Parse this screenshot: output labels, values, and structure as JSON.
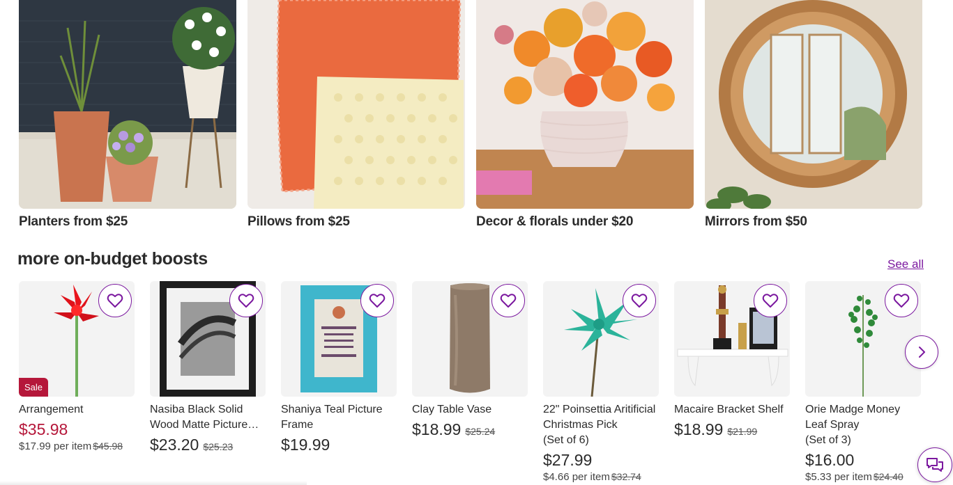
{
  "categories": [
    {
      "label": "Planters from $25"
    },
    {
      "label": "Pillows from $25"
    },
    {
      "label": "Decor & florals under $20"
    },
    {
      "label": "Mirrors from $50"
    }
  ],
  "section": {
    "title": "more on-budget boosts",
    "see_all": "See all"
  },
  "products": [
    {
      "name": "Arrangement",
      "badge": "Sale",
      "price": "$35.98",
      "per_item": "$17.99 per item",
      "was": "$45.98"
    },
    {
      "name": "Nasiba Black Solid Wood Matte Picture…",
      "price": "$23.20",
      "was": "$25.23"
    },
    {
      "name": "Shaniya Teal Picture Frame",
      "price": "$19.99"
    },
    {
      "name": "Clay Table Vase",
      "price": "$18.99",
      "was": "$25.24"
    },
    {
      "name": "22\" Poinsettia Aritificial Christmas Pick",
      "set": "(Set of 6)",
      "price": "$27.99",
      "per_item": "$4.66 per item",
      "was": "$32.74"
    },
    {
      "name": "Macaire Bracket Shelf",
      "price": "$18.99",
      "was": "$21.99"
    },
    {
      "name": "Orie Madge Money Leaf Spray",
      "set": "(Set of 3)",
      "price": "$16.00",
      "per_item": "$5.33 per item",
      "was": "$24.40"
    }
  ],
  "icons": {
    "favorite": "heart-icon",
    "next": "chevron-right-icon",
    "chat": "chat-icon"
  },
  "colors": {
    "brand": "#7b189f",
    "sale": "#b5173a"
  }
}
